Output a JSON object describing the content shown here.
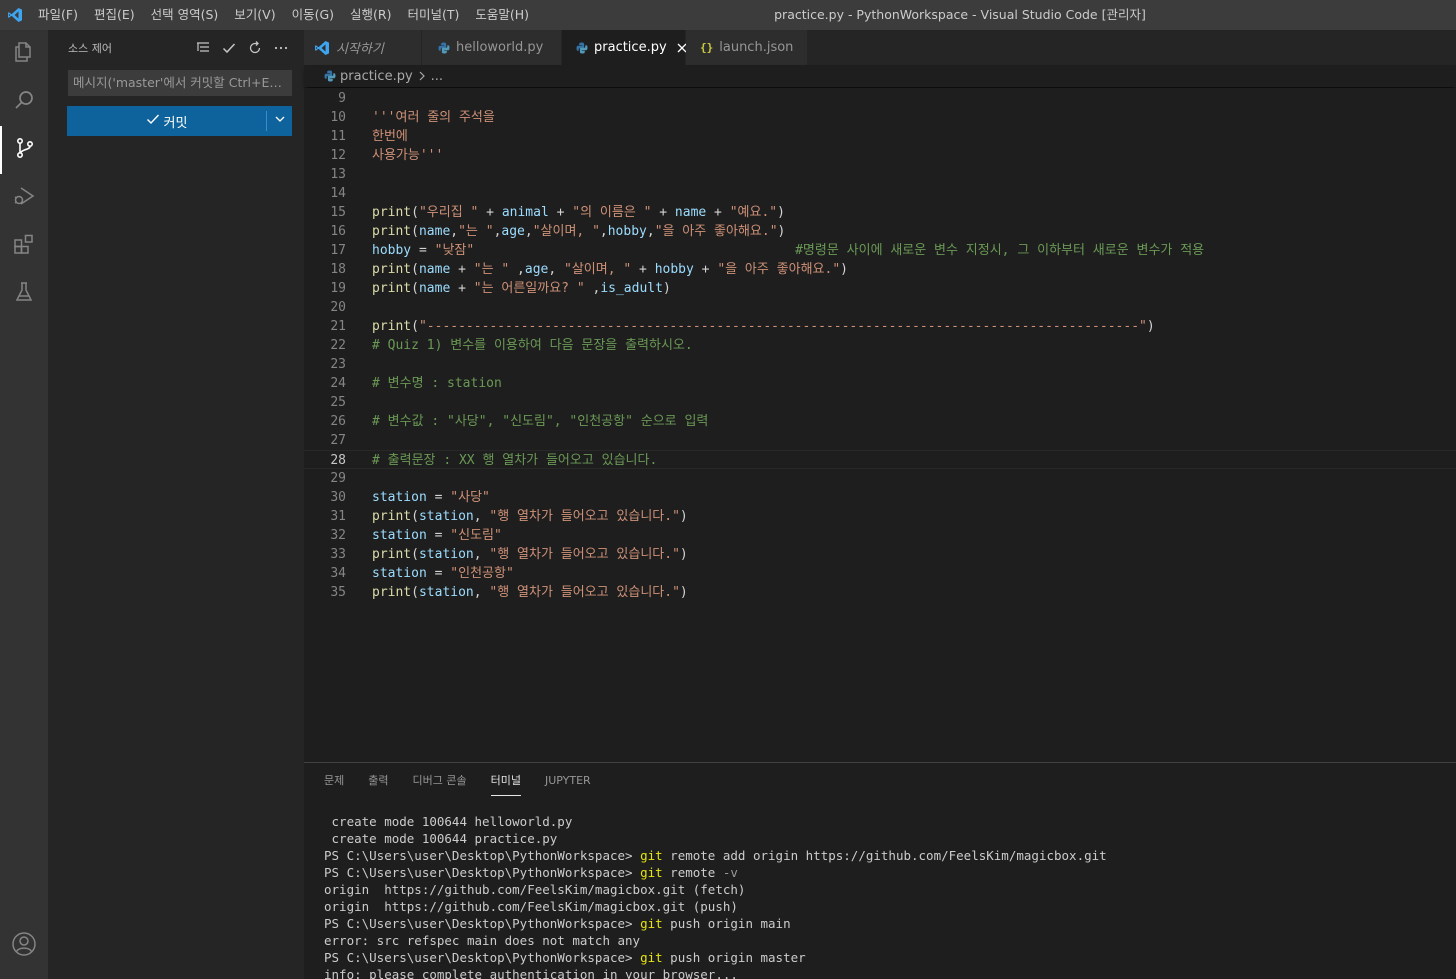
{
  "titlebar": {
    "menu": [
      "파일(F)",
      "편집(E)",
      "선택 영역(S)",
      "보기(V)",
      "이동(G)",
      "실행(R)",
      "터미널(T)",
      "도움말(H)"
    ],
    "window_title": "practice.py - PythonWorkspace - Visual Studio Code [관리자]"
  },
  "activitybar": {
    "items": [
      "files-icon",
      "search-icon",
      "source-control-icon",
      "run-debug-icon",
      "extensions-icon",
      "testing-icon"
    ],
    "bottom": "account-icon",
    "active": "source-control-icon"
  },
  "sidebar": {
    "title": "소스 제어",
    "commit_placeholder": "메시지('master'에서 커밋할 Ctrl+Ent...",
    "commit_label": "커밋"
  },
  "tabs": [
    {
      "label": "시작하기",
      "icon": "vscode-icon",
      "italic": true
    },
    {
      "label": "helloworld.py",
      "icon": "python-icon"
    },
    {
      "label": "practice.py",
      "icon": "python-icon",
      "active": true
    },
    {
      "label": "launch.json",
      "icon": "json-icon"
    }
  ],
  "breadcrumb": {
    "file": "practice.py",
    "more": "..."
  },
  "editor": {
    "current_line": 28,
    "lines": [
      {
        "n": "9",
        "t": []
      },
      {
        "n": "10",
        "t": [
          [
            "str",
            "'''여러 줄의 주석을"
          ]
        ]
      },
      {
        "n": "11",
        "t": [
          [
            "str",
            "한번에"
          ]
        ]
      },
      {
        "n": "12",
        "t": [
          [
            "str",
            "사용가능'''"
          ]
        ]
      },
      {
        "n": "13",
        "t": []
      },
      {
        "n": "14",
        "t": []
      },
      {
        "n": "15",
        "t": [
          [
            "fn",
            "print"
          ],
          [
            "op",
            "("
          ],
          [
            "str",
            "\"우리집 \""
          ],
          [
            "op",
            " + "
          ],
          [
            "var",
            "animal"
          ],
          [
            "op",
            " + "
          ],
          [
            "str",
            "\"의 이름은 \""
          ],
          [
            "op",
            " + "
          ],
          [
            "var",
            "name"
          ],
          [
            "op",
            " + "
          ],
          [
            "str",
            "\"예요.\""
          ],
          [
            "op",
            ")"
          ]
        ]
      },
      {
        "n": "16",
        "t": [
          [
            "fn",
            "print"
          ],
          [
            "op",
            "("
          ],
          [
            "var",
            "name"
          ],
          [
            "op",
            ","
          ],
          [
            "str",
            "\"는 \""
          ],
          [
            "op",
            ","
          ],
          [
            "var",
            "age"
          ],
          [
            "op",
            ","
          ],
          [
            "str",
            "\"살이며, \""
          ],
          [
            "op",
            ","
          ],
          [
            "var",
            "hobby"
          ],
          [
            "op",
            ","
          ],
          [
            "str",
            "\"을 아주 좋아해요.\""
          ],
          [
            "op",
            ")"
          ]
        ]
      },
      {
        "n": "17",
        "t": [
          [
            "var",
            "hobby"
          ],
          [
            "op",
            " = "
          ],
          [
            "str",
            "\"낮잠\""
          ],
          [
            "op",
            "                                         "
          ],
          [
            "cm",
            "#명령문 사이에 새로운 변수 지정시, 그 이하부터 새로운 변수가 적용"
          ]
        ]
      },
      {
        "n": "18",
        "t": [
          [
            "fn",
            "print"
          ],
          [
            "op",
            "("
          ],
          [
            "var",
            "name"
          ],
          [
            "op",
            " + "
          ],
          [
            "str",
            "\"는 \""
          ],
          [
            "op",
            " ,"
          ],
          [
            "var",
            "age"
          ],
          [
            "op",
            ", "
          ],
          [
            "str",
            "\"살이며, \""
          ],
          [
            "op",
            " + "
          ],
          [
            "var",
            "hobby"
          ],
          [
            "op",
            " + "
          ],
          [
            "str",
            "\"을 아주 좋아해요.\""
          ],
          [
            "op",
            ")"
          ]
        ]
      },
      {
        "n": "19",
        "t": [
          [
            "fn",
            "print"
          ],
          [
            "op",
            "("
          ],
          [
            "var",
            "name"
          ],
          [
            "op",
            " + "
          ],
          [
            "str",
            "\"는 어른일까요? \""
          ],
          [
            "op",
            " ,"
          ],
          [
            "var",
            "is_adult"
          ],
          [
            "op",
            ")"
          ]
        ]
      },
      {
        "n": "20",
        "t": []
      },
      {
        "n": "21",
        "t": [
          [
            "fn",
            "print"
          ],
          [
            "op",
            "("
          ],
          [
            "str",
            "\"-------------------------------------------------------------------------------------------\""
          ],
          [
            "op",
            ")"
          ]
        ]
      },
      {
        "n": "22",
        "t": [
          [
            "cm",
            "# Quiz 1) 변수를 이용하여 다음 문장을 출력하시오."
          ]
        ]
      },
      {
        "n": "23",
        "t": []
      },
      {
        "n": "24",
        "t": [
          [
            "cm",
            "# 변수명 : station"
          ]
        ]
      },
      {
        "n": "25",
        "t": []
      },
      {
        "n": "26",
        "t": [
          [
            "cm",
            "# 변수값 : \"사당\", \"신도림\", \"인천공항\" 순으로 입력"
          ]
        ]
      },
      {
        "n": "27",
        "t": []
      },
      {
        "n": "28",
        "t": [
          [
            "cm",
            "# 출력문장 : XX 행 열차가 들어오고 있습니다."
          ]
        ]
      },
      {
        "n": "29",
        "t": []
      },
      {
        "n": "30",
        "t": [
          [
            "var",
            "station"
          ],
          [
            "op",
            " = "
          ],
          [
            "str",
            "\"사당\""
          ]
        ]
      },
      {
        "n": "31",
        "t": [
          [
            "fn",
            "print"
          ],
          [
            "op",
            "("
          ],
          [
            "var",
            "station"
          ],
          [
            "op",
            ", "
          ],
          [
            "str",
            "\"행 열차가 들어오고 있습니다.\""
          ],
          [
            "op",
            ")"
          ]
        ]
      },
      {
        "n": "32",
        "t": [
          [
            "var",
            "station"
          ],
          [
            "op",
            " = "
          ],
          [
            "str",
            "\"신도림\""
          ]
        ]
      },
      {
        "n": "33",
        "t": [
          [
            "fn",
            "print"
          ],
          [
            "op",
            "("
          ],
          [
            "var",
            "station"
          ],
          [
            "op",
            ", "
          ],
          [
            "str",
            "\"행 열차가 들어오고 있습니다.\""
          ],
          [
            "op",
            ")"
          ]
        ]
      },
      {
        "n": "34",
        "t": [
          [
            "var",
            "station"
          ],
          [
            "op",
            " = "
          ],
          [
            "str",
            "\"인천공항\""
          ]
        ]
      },
      {
        "n": "35",
        "t": [
          [
            "fn",
            "print"
          ],
          [
            "op",
            "("
          ],
          [
            "var",
            "station"
          ],
          [
            "op",
            ", "
          ],
          [
            "str",
            "\"행 열차가 들어오고 있습니다.\""
          ],
          [
            "op",
            ")"
          ]
        ]
      }
    ]
  },
  "panel": {
    "tabs": [
      "문제",
      "출력",
      "디버그 콘솔",
      "터미널",
      "JUPYTER"
    ],
    "active_tab": "터미널",
    "terminal_lines": [
      [
        [
          "targ",
          " create mode 100644 helloworld.py"
        ]
      ],
      [
        [
          "targ",
          " create mode 100644 practice.py"
        ]
      ],
      [
        [
          "targ",
          "PS C:\\Users\\user\\Desktop\\PythonWorkspace> "
        ],
        [
          "tcmd",
          "git"
        ],
        [
          "targ",
          " remote add origin https://github.com/FeelsKim/magicbox.git"
        ]
      ],
      [
        [
          "targ",
          "PS C:\\Users\\user\\Desktop\\PythonWorkspace> "
        ],
        [
          "tcmd",
          "git"
        ],
        [
          "targ",
          " remote "
        ],
        [
          "tflag",
          "-v"
        ]
      ],
      [
        [
          "targ",
          "origin  https://github.com/FeelsKim/magicbox.git (fetch)"
        ]
      ],
      [
        [
          "targ",
          "origin  https://github.com/FeelsKim/magicbox.git (push)"
        ]
      ],
      [
        [
          "targ",
          "PS C:\\Users\\user\\Desktop\\PythonWorkspace> "
        ],
        [
          "tcmd",
          "git"
        ],
        [
          "targ",
          " push origin main"
        ]
      ],
      [
        [
          "targ",
          "error: src refspec main does not match any"
        ]
      ],
      [
        [
          "targ",
          "PS C:\\Users\\user\\Desktop\\PythonWorkspace> "
        ],
        [
          "tcmd",
          "git"
        ],
        [
          "targ",
          " push origin master"
        ]
      ],
      [
        [
          "targ",
          "info: please complete authentication in your browser..."
        ]
      ]
    ]
  },
  "colors": {
    "accent": "#0e639c",
    "string": "#ce9178",
    "function": "#dcdcaa",
    "variable": "#9cdcfe",
    "comment": "#6a9955",
    "terminal_command": "#e5e510"
  }
}
